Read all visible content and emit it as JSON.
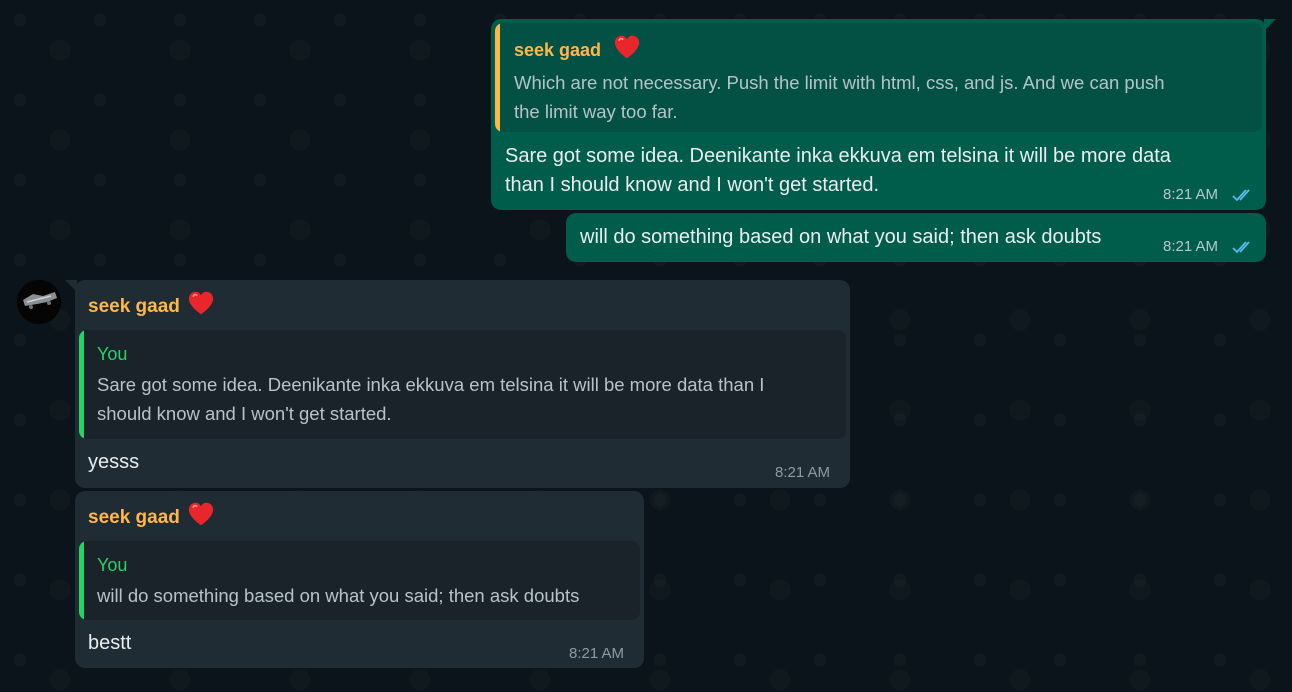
{
  "colors": {
    "outgoing_bubble": "#005c4b",
    "incoming_bubble": "#202c33",
    "sender_name": "#ffb64a",
    "quote_you": "#25d366",
    "quote_bar_out": "#ffb64a",
    "read_ticks": "#53bdeb"
  },
  "messages": [
    {
      "direction": "outgoing",
      "quote": {
        "author": "seek gaad",
        "author_icon": "heart-emoji",
        "text_line1": "Which are not necessary. Push the limit with html, css, and js. And we can push",
        "text_line2": "the limit way too far."
      },
      "text_line1": "Sare got some idea. Deenikante inka ekkuva em telsina it will be more data",
      "text_line2": "than I should know and I won't get started.",
      "time": "8:21 AM",
      "status_icon": "double-check-read-icon"
    },
    {
      "direction": "outgoing",
      "text": "will do something based on what you said; then ask doubts",
      "time": "8:21 AM",
      "status_icon": "double-check-read-icon"
    },
    {
      "direction": "incoming",
      "sender": "seek gaad",
      "sender_icon": "heart-emoji",
      "quote": {
        "author": "You",
        "text_line1": "Sare got some idea. Deenikante inka ekkuva em telsina it will be more data than I",
        "text_line2": "should know and I won't get started."
      },
      "text": "yesss",
      "time": "8:21 AM"
    },
    {
      "direction": "incoming",
      "sender": "seek gaad",
      "sender_icon": "heart-emoji",
      "quote": {
        "author": "You",
        "text_line1": "will do something based on what you said; then ask doubts"
      },
      "text": "bestt",
      "time": "8:21 AM"
    }
  ]
}
